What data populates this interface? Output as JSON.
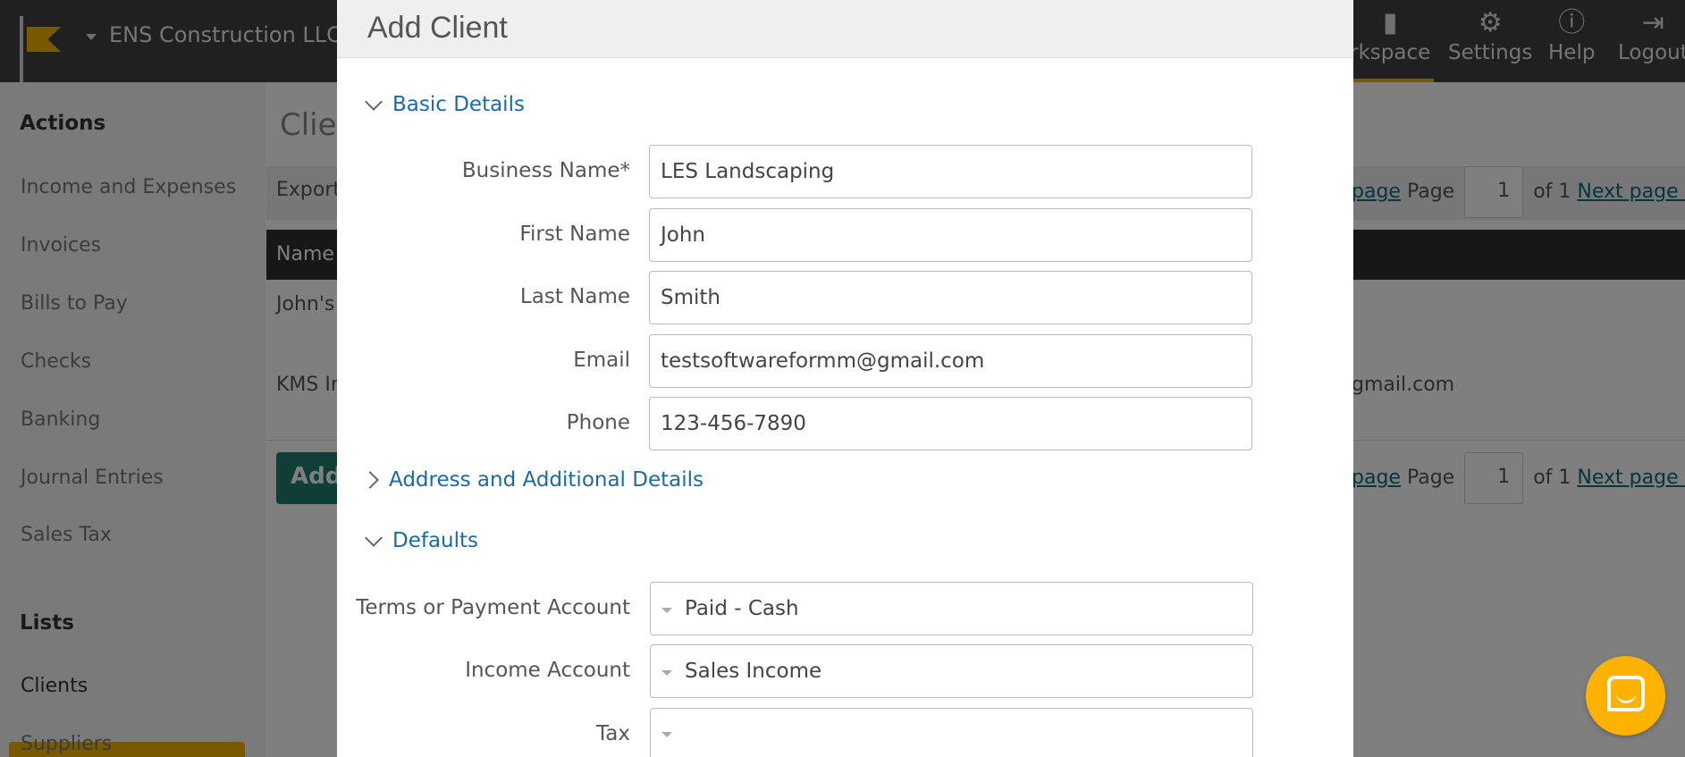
{
  "topbar": {
    "company_name": "ENS Construction LLC",
    "nav": [
      {
        "label": "rkspace",
        "icon": "book-icon"
      },
      {
        "label": "Settings",
        "icon": "gear-icon"
      },
      {
        "label": "Help",
        "icon": "help-icon"
      },
      {
        "label": "Logout",
        "icon": "logout-icon"
      }
    ]
  },
  "sidebar": {
    "actions_heading": "Actions",
    "actions": [
      "Income and Expenses",
      "Invoices",
      "Bills to Pay",
      "Checks",
      "Banking",
      "Journal Entries",
      "Sales Tax"
    ],
    "lists_heading": "Lists",
    "lists": [
      "Clients",
      "Suppliers"
    ]
  },
  "main": {
    "title": "Clie",
    "export_label": "Export",
    "pager": {
      "prev": "page",
      "page_word": "Page",
      "page_value": "1",
      "of": "of 1",
      "next": "Next page »"
    },
    "table_header": "Name",
    "rows": [
      "John's",
      "KMS In"
    ],
    "email_fragment": "gmail.com",
    "add_button": "Add"
  },
  "modal": {
    "title": "Add Client",
    "sections": {
      "basic": "Basic Details",
      "address": "Address and Additional Details",
      "defaults": "Defaults"
    },
    "fields": {
      "business_name": {
        "label": "Business Name*",
        "value": "LES Landscaping"
      },
      "first_name": {
        "label": "First Name",
        "value": "John"
      },
      "last_name": {
        "label": "Last Name",
        "value": "Smith"
      },
      "email": {
        "label": "Email",
        "value": "testsoftwareformm@gmail.com"
      },
      "phone": {
        "label": "Phone",
        "value": "123-456-7890"
      },
      "terms": {
        "label": "Terms or Payment Account",
        "value": "Paid - Cash"
      },
      "income_account": {
        "label": "Income Account",
        "value": "Sales Income"
      },
      "tax": {
        "label": "Tax",
        "value": ""
      }
    }
  },
  "colors": {
    "accent": "#f2b200",
    "link": "#1a6aa8",
    "chat": "#ffb300"
  }
}
